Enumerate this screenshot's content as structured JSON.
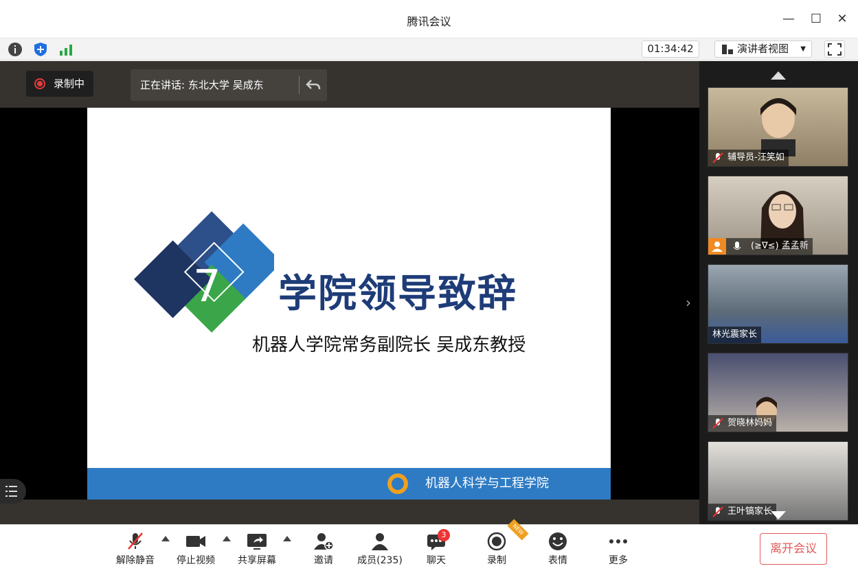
{
  "window": {
    "title": "腾讯会议",
    "controls": {
      "minimize": "—",
      "maximize": "☐",
      "close": "✕"
    }
  },
  "toolbar": {
    "timer": "01:34:42",
    "view_mode": "演讲者视图",
    "icons": [
      "info-icon",
      "shield-icon",
      "signal-icon",
      "fullscreen-icon"
    ]
  },
  "stage": {
    "recording_label": "录制中",
    "speaking_label": "正在讲话: 东北大学 吴成东",
    "slide": {
      "logo_number": "7",
      "title": "学院领导致辞",
      "subtitle": "机器人学院常务副院长  吴成东教授",
      "footer": "机器人科学与工程学院"
    }
  },
  "participants": [
    {
      "name": "辅导员-汪笑如",
      "muted": true
    },
    {
      "name": "(≥∇≤) 孟孟新",
      "muted": false,
      "host": true
    },
    {
      "name": "林光震家长",
      "muted": false
    },
    {
      "name": "贺晓林妈妈",
      "muted": true
    },
    {
      "name": "王叶镐家长",
      "muted": true
    }
  ],
  "bottom": {
    "unmute": "解除静音",
    "stop_video": "停止视频",
    "share_screen": "共享屏幕",
    "invite": "邀请",
    "members": "成员(235)",
    "chat": "聊天",
    "chat_badge": "3",
    "record": "录制",
    "record_badge": "NEW",
    "emoji": "表情",
    "more": "更多",
    "leave": "离开会议"
  },
  "colors": {
    "accent_red": "#e25b5b",
    "slide_blue": "#1e3c78",
    "footer_blue": "#2e7bc4",
    "green": "#27a844"
  }
}
